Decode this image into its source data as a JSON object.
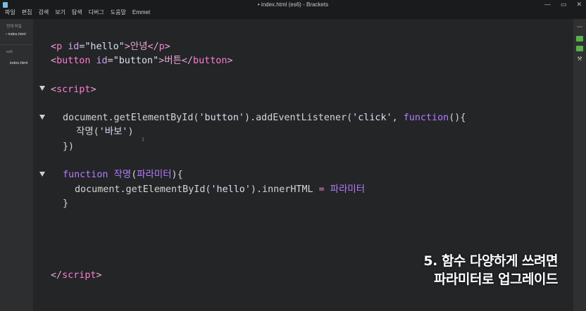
{
  "window": {
    "title": "• index.html (es6) - Brackets",
    "controls": [
      "—",
      "▭",
      "✕"
    ]
  },
  "menu": [
    "파일",
    "편집",
    "검색",
    "보기",
    "탐색",
    "디버그",
    "도움말",
    "Emmet"
  ],
  "sidebar": {
    "working_files_label": "현재 파일",
    "working_file": "index.html",
    "project_label": "es6",
    "project_file": "index.html"
  },
  "code": {
    "line1": [
      "<",
      "p",
      "id",
      "=",
      "\"hello\"",
      ">안녕</",
      "p",
      ">"
    ],
    "line2": [
      "<",
      "button",
      "id",
      "=",
      "\"button\"",
      ">버튼</",
      "button",
      ">"
    ],
    "line3": [
      "<",
      "script",
      ">"
    ],
    "line4": [
      "document.getElementById(",
      "'button'",
      ").addEventListener(",
      "'click'",
      ", ",
      "function",
      "(){"
    ],
    "line5": [
      "작명(",
      "'바보'",
      ")"
    ],
    "line6": "})",
    "line7": [
      "function",
      " 작명",
      "(",
      "파라미터",
      "){"
    ],
    "line8": [
      "document.getElementById(",
      "'hello'",
      ").innerHTML ",
      "=",
      " ",
      "파라미터"
    ],
    "line9": "}",
    "line10": [
      "</",
      "script",
      ">"
    ]
  },
  "caption": {
    "line1": "5. 함수 다양하게 쓰려면",
    "line2": "파라미터로 업그레이드"
  },
  "colors": {
    "editor_bg": "#232527",
    "tag": "#ff7bd2",
    "keyword": "#b57bff",
    "accent": "#6fb3ff"
  },
  "right_toolbar_icons": [
    "live-preview-icon",
    "extension-manager-icon",
    "extension-icon",
    "hint-icon"
  ]
}
